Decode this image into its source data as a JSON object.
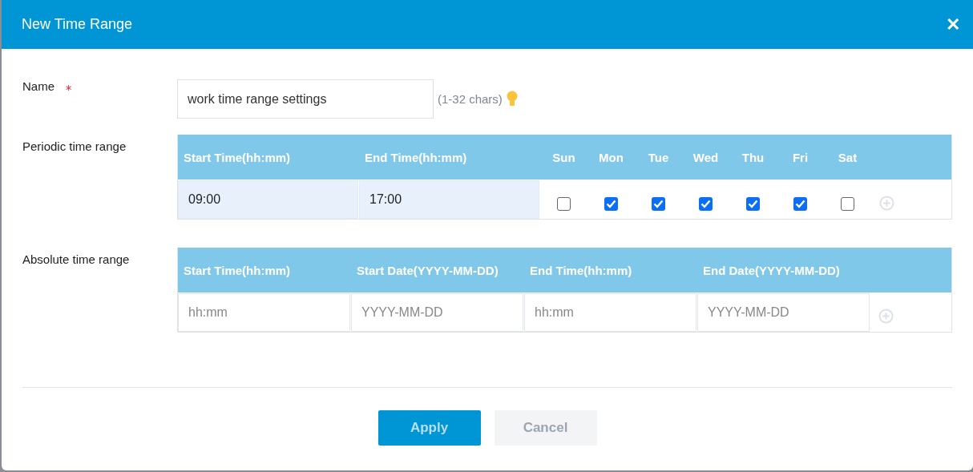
{
  "dialog": {
    "title": "New Time Range",
    "close": "✕"
  },
  "name_field": {
    "label": "Name",
    "required_mark": "*",
    "value": "work time range settings",
    "hint": "(1-32 chars)"
  },
  "periodic": {
    "label": "Periodic time range",
    "columns": [
      "Start Time(hh:mm)",
      "End Time(hh:mm)"
    ],
    "days": [
      {
        "label": "Sun",
        "checked": false
      },
      {
        "label": "Mon",
        "checked": true
      },
      {
        "label": "Tue",
        "checked": true
      },
      {
        "label": "Wed",
        "checked": true
      },
      {
        "label": "Thu",
        "checked": true
      },
      {
        "label": "Fri",
        "checked": true
      },
      {
        "label": "Sat",
        "checked": false
      }
    ],
    "row": {
      "start": "09:00",
      "end": "17:00"
    }
  },
  "absolute": {
    "label": "Absolute time range",
    "columns": [
      "Start Time(hh:mm)",
      "Start Date(YYYY-MM-DD)",
      "End Time(hh:mm)",
      "End Date(YYYY-MM-DD)"
    ],
    "placeholders": [
      "hh:mm",
      "YYYY-MM-DD",
      "hh:mm",
      "YYYY-MM-DD"
    ]
  },
  "buttons": [
    {
      "label": "Apply",
      "kind": "primary"
    },
    {
      "label": "Cancel",
      "kind": "secondary"
    }
  ]
}
